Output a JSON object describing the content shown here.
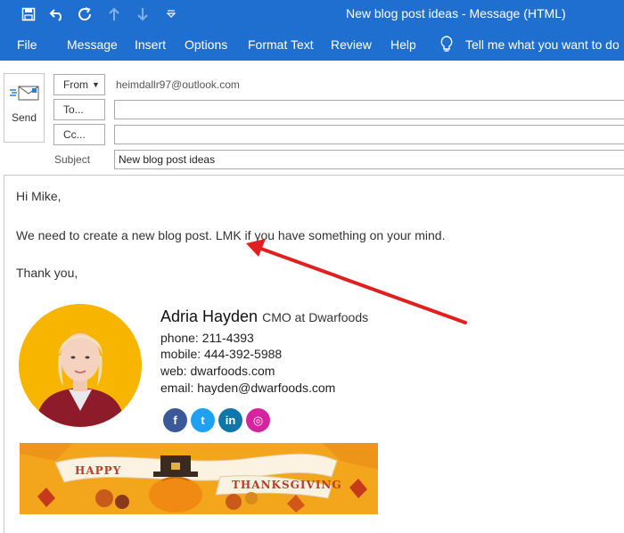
{
  "window": {
    "title": "New blog post ideas  -  Message (HTML)"
  },
  "ribbon": {
    "tabs": [
      "File",
      "Message",
      "Insert",
      "Options",
      "Format Text",
      "Review",
      "Help"
    ],
    "tell_me": "Tell me what you want to do"
  },
  "header": {
    "send_label": "Send",
    "from_label": "From",
    "from_value": "heimdallr97@outlook.com",
    "to_label": "To...",
    "to_value": "",
    "cc_label": "Cc...",
    "cc_value": "",
    "subject_label": "Subject",
    "subject_value": "New blog post ideas"
  },
  "message": {
    "greeting": "Hi Mike,",
    "line1": "We need to create a new blog post. LMK if you have something on your mind.",
    "closing": "Thank you,"
  },
  "signature": {
    "name": "Adria Hayden",
    "role": "CMO at Dwarfoods",
    "phone": "phone: 211-4393",
    "mobile": "mobile: 444-392-5988",
    "web": "web: dwarfoods.com",
    "email": "email: hayden@dwarfoods.com",
    "social": [
      {
        "name": "facebook-icon",
        "glyph": "f",
        "color": "#3b5998"
      },
      {
        "name": "twitter-icon",
        "glyph": "t",
        "color": "#1da1f2"
      },
      {
        "name": "linkedin-icon",
        "glyph": "in",
        "color": "#0e76a8"
      },
      {
        "name": "instagram-icon",
        "glyph": "◎",
        "color": "#d6249f"
      }
    ],
    "banner": {
      "word1": "HAPPY",
      "word2": "THANKSGIVING"
    }
  },
  "colors": {
    "ribbon": "#1f6fd1",
    "annotation_arrow": "#e02020",
    "avatar_bg": "#f7b500"
  }
}
